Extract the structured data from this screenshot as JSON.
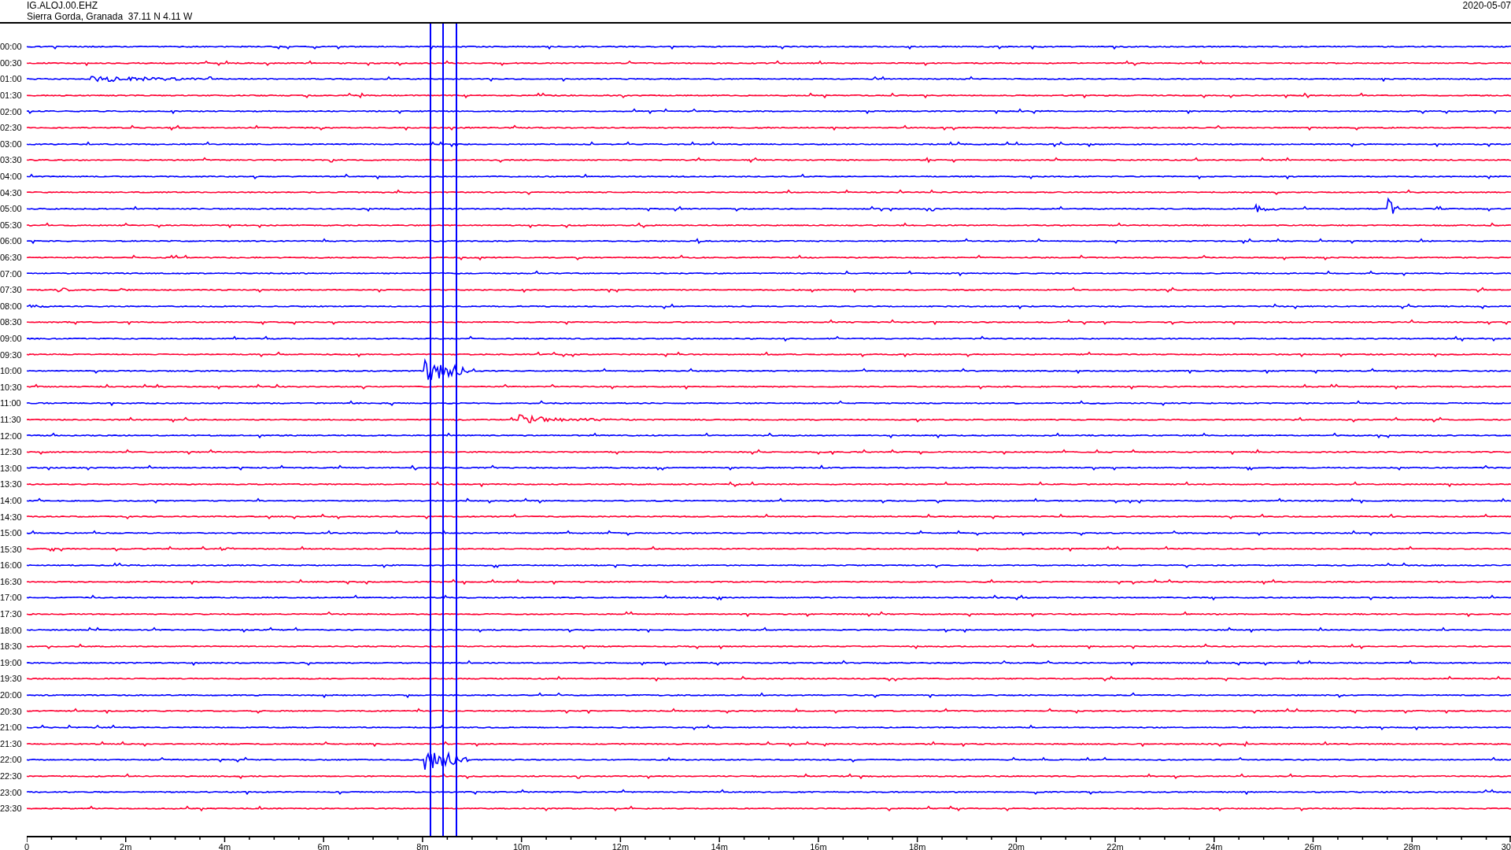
{
  "header": {
    "station": "IG.ALOJ.00.EHZ",
    "location": "Sierra Gorda, Granada  37.11 N 4.11 W",
    "date": "2020-05-07"
  },
  "rows": [
    {
      "label": "00:00",
      "color": "#0000ff"
    },
    {
      "label": "00:30",
      "color": "#ff0033"
    },
    {
      "label": "01:00",
      "color": "#0000ff"
    },
    {
      "label": "01:30",
      "color": "#ff0033"
    },
    {
      "label": "02:00",
      "color": "#0000ff"
    },
    {
      "label": "02:30",
      "color": "#ff0033"
    },
    {
      "label": "03:00",
      "color": "#0000ff"
    },
    {
      "label": "03:30",
      "color": "#ff0033"
    },
    {
      "label": "04:00",
      "color": "#0000ff"
    },
    {
      "label": "04:30",
      "color": "#ff0033"
    },
    {
      "label": "05:00",
      "color": "#0000ff"
    },
    {
      "label": "05:30",
      "color": "#ff0033"
    },
    {
      "label": "06:00",
      "color": "#0000ff"
    },
    {
      "label": "06:30",
      "color": "#ff0033"
    },
    {
      "label": "07:00",
      "color": "#0000ff"
    },
    {
      "label": "07:30",
      "color": "#ff0033"
    },
    {
      "label": "08:00",
      "color": "#0000ff"
    },
    {
      "label": "08:30",
      "color": "#ff0033"
    },
    {
      "label": "09:00",
      "color": "#0000ff"
    },
    {
      "label": "09:30",
      "color": "#ff0033"
    },
    {
      "label": "10:00",
      "color": "#0000ff"
    },
    {
      "label": "10:30",
      "color": "#ff0033"
    },
    {
      "label": "11:00",
      "color": "#0000ff"
    },
    {
      "label": "11:30",
      "color": "#ff0033"
    },
    {
      "label": "12:00",
      "color": "#0000ff"
    },
    {
      "label": "12:30",
      "color": "#ff0033"
    },
    {
      "label": "13:00",
      "color": "#0000ff"
    },
    {
      "label": "13:30",
      "color": "#ff0033"
    },
    {
      "label": "14:00",
      "color": "#0000ff"
    },
    {
      "label": "14:30",
      "color": "#ff0033"
    },
    {
      "label": "15:00",
      "color": "#0000ff"
    },
    {
      "label": "15:30",
      "color": "#ff0033"
    },
    {
      "label": "16:00",
      "color": "#0000ff"
    },
    {
      "label": "16:30",
      "color": "#ff0033"
    },
    {
      "label": "17:00",
      "color": "#0000ff"
    },
    {
      "label": "17:30",
      "color": "#ff0033"
    },
    {
      "label": "18:00",
      "color": "#0000ff"
    },
    {
      "label": "18:30",
      "color": "#ff0033"
    },
    {
      "label": "19:00",
      "color": "#0000ff"
    },
    {
      "label": "19:30",
      "color": "#ff0033"
    },
    {
      "label": "20:00",
      "color": "#0000ff"
    },
    {
      "label": "20:30",
      "color": "#ff0033"
    },
    {
      "label": "21:00",
      "color": "#0000ff"
    },
    {
      "label": "21:30",
      "color": "#ff0033"
    },
    {
      "label": "22:00",
      "color": "#0000ff"
    },
    {
      "label": "22:30",
      "color": "#ff0033"
    },
    {
      "label": "23:00",
      "color": "#0000ff"
    },
    {
      "label": "23:30",
      "color": "#ff0033"
    }
  ],
  "x_axis": {
    "tick_labels": [
      "0",
      "2m",
      "4m",
      "6m",
      "8m",
      "10m",
      "12m",
      "14m",
      "16m",
      "18m",
      "20m",
      "22m",
      "24m",
      "26m",
      "28m",
      "30"
    ]
  }
}
